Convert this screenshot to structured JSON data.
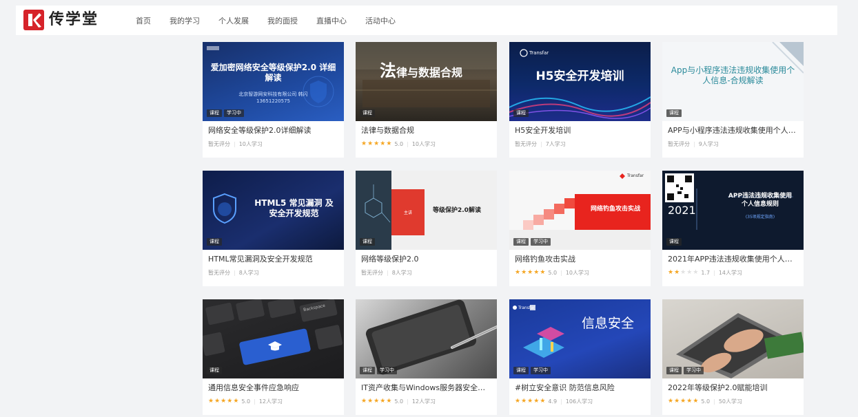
{
  "header": {
    "logo_text": "传学堂",
    "nav": [
      "首页",
      "我的学习",
      "个人发展",
      "我的面授",
      "直播中心",
      "活动中心"
    ]
  },
  "courses": [
    {
      "title": "网络安全等级保护2.0详细解读",
      "tags": [
        "课程",
        "学习中"
      ],
      "rating_label": "暂无评分",
      "learners": "10人学习",
      "cover_title": "爱加密网络安全等级保护2.0 详细解读",
      "cover_sub": "北京智游网安科技有限公司 韩闪 13651220575"
    },
    {
      "title": "法律与数据合规",
      "tags": [
        "课程"
      ],
      "stars": 5,
      "score": "5.0",
      "learners": "10人学习",
      "cover_title": "法律与数据合规",
      "cover_title_part1": "法",
      "cover_title_part2": "律与数据合规"
    },
    {
      "title": "H5安全开发培训",
      "tags": [
        "课程"
      ],
      "rating_label": "暂无评分",
      "learners": "7人学习",
      "cover_title": "H5安全开发培训",
      "cover_brand": "Transfar"
    },
    {
      "title": "APP与小程序违法违规收集使用个人信...",
      "tags": [
        "课程"
      ],
      "rating_label": "暂无评分",
      "learners": "9人学习",
      "cover_title": "App与小程序违法违规收集使用个人信息-合规解读"
    },
    {
      "title": "HTML常见漏洞及安全开发规范",
      "tags": [
        "课程"
      ],
      "rating_label": "暂无评分",
      "learners": "8人学习",
      "cover_title": "HTML5 常见漏洞 及安全开发规范"
    },
    {
      "title": "网络等级保护2.0",
      "tags": [
        "课程"
      ],
      "rating_label": "暂无评分",
      "learners": "8人学习",
      "cover_title": "等级保护2.0解读",
      "cover_box_label": "主讲"
    },
    {
      "title": "网络钓鱼攻击实战",
      "tags": [
        "课程",
        "学习中"
      ],
      "stars": 5,
      "score": "5.0",
      "learners": "10人学习",
      "cover_title": "网络钓鱼攻击实战",
      "cover_brand": "Transfar"
    },
    {
      "title": "2021年APP违法违规收集使用个人信...",
      "tags": [
        "课程"
      ],
      "stars": 2,
      "score": "1.7",
      "learners": "14人学习",
      "cover_title": "APP违法违规收集使用个人信息规则",
      "cover_year": "2021",
      "cover_sub": "(35项规定指南)"
    },
    {
      "title": "通用信息安全事件应急响应",
      "tags": [
        "课程"
      ],
      "stars": 5,
      "score": "5.0",
      "learners": "12人学习",
      "cover_key_label": "Backspace"
    },
    {
      "title": "IT资产收集与Windows服务器安全加固",
      "tags": [
        "课程",
        "学习中"
      ],
      "stars": 5,
      "score": "5.0",
      "learners": "12人学习"
    },
    {
      "title": "#树立安全意识 防范信息风险",
      "tags": [
        "课程",
        "学习中"
      ],
      "stars": 5,
      "score": "4.9",
      "learners": "106人学习",
      "cover_title": "信息安全",
      "cover_brand": "Transfar"
    },
    {
      "title": "2022年等级保护2.0赋能培训",
      "tags": [
        "课程",
        "学习中"
      ],
      "stars": 5,
      "score": "5.0",
      "learners": "50人学习"
    }
  ],
  "colors": {
    "star_on": "#f5a623",
    "star_off": "#e1e1e1",
    "logo_red": "#d6232a"
  }
}
